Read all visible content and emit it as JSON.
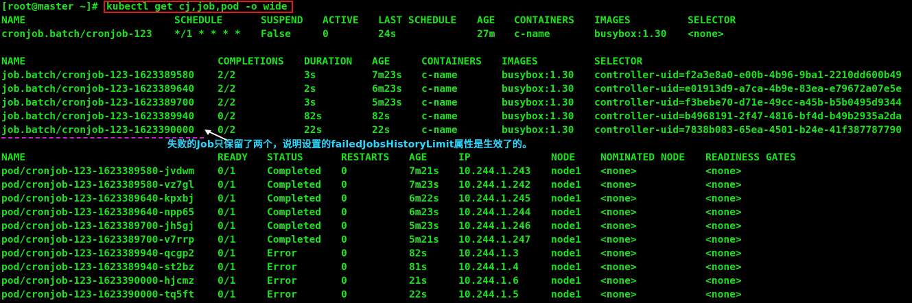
{
  "terminal": {
    "prompt": "[root@master ~]#",
    "command": "kubectl get cj,job,pod -o wide"
  },
  "cronjobs": {
    "headers": [
      "NAME",
      "SCHEDULE",
      "SUSPEND",
      "ACTIVE",
      "LAST SCHEDULE",
      "AGE",
      "CONTAINERS",
      "IMAGES",
      "SELECTOR"
    ],
    "rows": [
      [
        "cronjob.batch/cronjob-123",
        "*/1 * * * *",
        "False",
        "0",
        "24s",
        "27m",
        "c-name",
        "busybox:1.30",
        "<none>"
      ]
    ]
  },
  "jobs": {
    "headers": [
      "NAME",
      "COMPLETIONS",
      "DURATION",
      "AGE",
      "CONTAINERS",
      "IMAGES",
      "SELECTOR"
    ],
    "rows": [
      [
        "job.batch/cronjob-123-1623389580",
        "2/2",
        "3s",
        "7m23s",
        "c-name",
        "busybox:1.30",
        "controller-uid=f2a3e8a0-e00b-4b96-9ba1-2210dd600b49"
      ],
      [
        "job.batch/cronjob-123-1623389640",
        "2/2",
        "2s",
        "6m23s",
        "c-name",
        "busybox:1.30",
        "controller-uid=e01913d9-a7ca-4b9e-83ea-e79672a07e5e"
      ],
      [
        "job.batch/cronjob-123-1623389700",
        "2/2",
        "3s",
        "5m23s",
        "c-name",
        "busybox:1.30",
        "controller-uid=f3bebe70-d71e-49cc-a45b-b5b0495d9344"
      ],
      [
        "job.batch/cronjob-123-1623389940",
        "0/2",
        "82s",
        "82s",
        "c-name",
        "busybox:1.30",
        "controller-uid=b4968191-2f47-4816-bf4d-b49b2935a2da"
      ],
      [
        "job.batch/cronjob-123-1623390000",
        "0/2",
        "22s",
        "22s",
        "c-name",
        "busybox:1.30",
        "controller-uid=7838b083-65ea-4501-b24e-41f387787790"
      ]
    ]
  },
  "annotation": {
    "text": "失败的Job只保留了两个，说明设置的failedJobsHistoryLimit属性是生效了的。",
    "color": "#2ad8ff",
    "marker_color": "#d21ed2"
  },
  "pods": {
    "headers": [
      "NAME",
      "READY",
      "STATUS",
      "RESTARTS",
      "AGE",
      "IP",
      "NODE",
      "NOMINATED NODE",
      "READINESS GATES"
    ],
    "rows": [
      [
        "pod/cronjob-123-1623389580-jvdwm",
        "0/1",
        "Completed",
        "0",
        "7m21s",
        "10.244.1.243",
        "node1",
        "<none>",
        "<none>"
      ],
      [
        "pod/cronjob-123-1623389580-vz7gl",
        "0/1",
        "Completed",
        "0",
        "7m23s",
        "10.244.1.242",
        "node1",
        "<none>",
        "<none>"
      ],
      [
        "pod/cronjob-123-1623389640-kpxbj",
        "0/1",
        "Completed",
        "0",
        "6m22s",
        "10.244.1.245",
        "node1",
        "<none>",
        "<none>"
      ],
      [
        "pod/cronjob-123-1623389640-npp65",
        "0/1",
        "Completed",
        "0",
        "6m23s",
        "10.244.1.244",
        "node1",
        "<none>",
        "<none>"
      ],
      [
        "pod/cronjob-123-1623389700-jh5gj",
        "0/1",
        "Completed",
        "0",
        "5m23s",
        "10.244.1.246",
        "node1",
        "<none>",
        "<none>"
      ],
      [
        "pod/cronjob-123-1623389700-v7rrp",
        "0/1",
        "Completed",
        "0",
        "5m21s",
        "10.244.1.247",
        "node1",
        "<none>",
        "<none>"
      ],
      [
        "pod/cronjob-123-1623389940-qcgp2",
        "0/1",
        "Error",
        "0",
        "82s",
        "10.244.1.3",
        "node1",
        "<none>",
        "<none>"
      ],
      [
        "pod/cronjob-123-1623389940-st2bz",
        "0/1",
        "Error",
        "0",
        "81s",
        "10.244.1.4",
        "node1",
        "<none>",
        "<none>"
      ],
      [
        "pod/cronjob-123-1623390000-hjcmz",
        "0/1",
        "Error",
        "0",
        "21s",
        "10.244.1.6",
        "node1",
        "<none>",
        "<none>"
      ],
      [
        "pod/cronjob-123-1623390000-tq5ft",
        "0/1",
        "Error",
        "0",
        "22s",
        "10.244.1.5",
        "node1",
        "<none>",
        "<none>"
      ]
    ]
  },
  "colors": {
    "text": "#1ee01e",
    "background": "#000000",
    "command_box": "#e01b1b"
  }
}
